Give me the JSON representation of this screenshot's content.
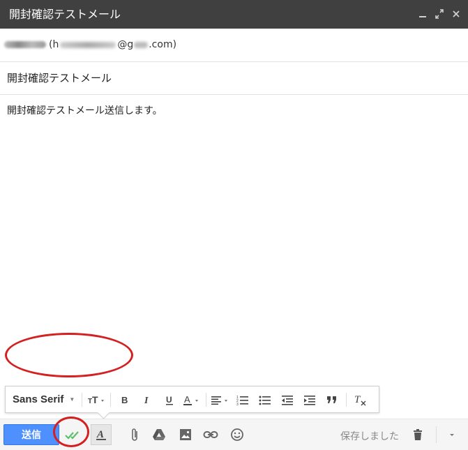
{
  "window": {
    "title": "開封確認テストメール",
    "controls": [
      "minimize-icon",
      "expand-icon",
      "close-icon"
    ]
  },
  "recipient": {
    "text_open": "(h",
    "text_mid": "@g",
    "text_end": ".com)"
  },
  "subject": "開封確認テストメール",
  "body": "開封確認テストメール送信します。",
  "format_bar": {
    "font": "Sans Serif",
    "buttons": [
      "font-size",
      "bold",
      "italic",
      "underline",
      "text-color",
      "align",
      "numbered-list",
      "bulleted-list",
      "indent-less",
      "indent-more",
      "quote",
      "remove-formatting"
    ]
  },
  "bottom_bar": {
    "send_label": "送信",
    "saved_status": "保存しました"
  },
  "colors": {
    "titlebar": "#404040",
    "send": "#4d90fe",
    "annotation": "#d42020",
    "check": "#5cc06a"
  }
}
